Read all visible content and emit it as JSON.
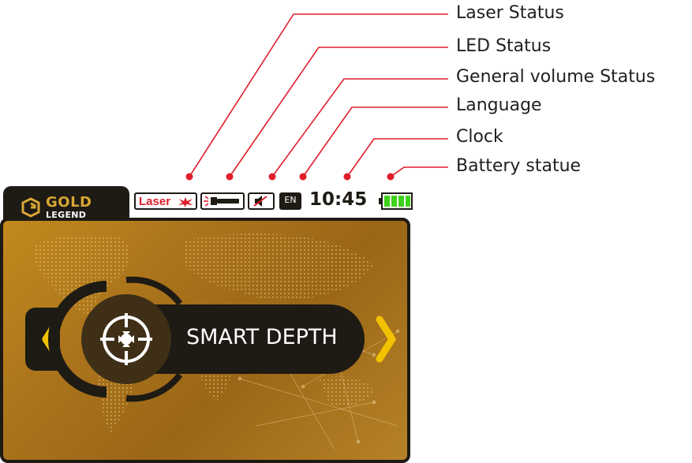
{
  "callouts": [
    {
      "label": "Laser Status"
    },
    {
      "label": "LED Status"
    },
    {
      "label": "General volume Status"
    },
    {
      "label": "Language"
    },
    {
      "label": "Clock"
    },
    {
      "label": "Battery statue"
    }
  ],
  "device": {
    "brand": {
      "line1": "GOLD",
      "line2": "LEGEND"
    },
    "status_bar": {
      "laser_text": "Laser",
      "language": "EN",
      "clock": "10:45",
      "battery_level": 1.0,
      "led_icon": "flashlight-icon",
      "volume_icon": "speaker-muted-icon"
    },
    "mode": {
      "title": "SMART DEPTH",
      "mode_icon": "crosshair-target-icon",
      "prev_icon": "chevron-left-icon",
      "next_icon": "chevron-right-icon"
    }
  },
  "colors": {
    "gold": "#d8a635",
    "dark": "#1e1a14",
    "accent_red": "#e11d2a",
    "battery_green": "#3fd21a",
    "chevron_yellow": "#f2c200"
  }
}
